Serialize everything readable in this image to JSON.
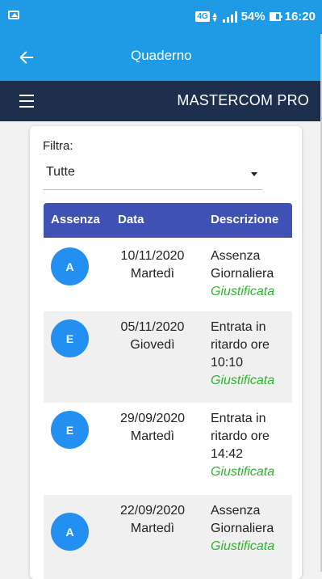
{
  "status_bar": {
    "network": "4G",
    "battery": "54%",
    "time": "16:20",
    "icons": [
      "gallery-icon",
      "signal-icon",
      "battery-icon"
    ]
  },
  "app_bar": {
    "title": "Quaderno",
    "back_icon": "arrow-left-icon"
  },
  "nav_bar": {
    "brand": "MASTERCOM PRO",
    "menu_icon": "hamburger-icon"
  },
  "filter": {
    "label": "Filtra:",
    "value": "Tutte"
  },
  "table": {
    "headers": [
      "Assenza",
      "Data",
      "Descrizione"
    ],
    "rows": [
      {
        "type": "A",
        "date": "10/11/2020",
        "day": "Martedì",
        "desc": [
          "Assenza",
          "Giornaliera"
        ],
        "status": "Giustificata"
      },
      {
        "type": "E",
        "date": "05/11/2020",
        "day": "Giovedì",
        "desc": [
          "Entrata in",
          "ritardo ore",
          "10:10"
        ],
        "status": "Giustificata"
      },
      {
        "type": "E",
        "date": "29/09/2020",
        "day": "Martedì",
        "desc": [
          "Entrata in",
          "ritardo ore",
          "14:42"
        ],
        "status": "Giustificata"
      },
      {
        "type": "A",
        "date": "22/09/2020",
        "day": "Martedì",
        "desc": [
          "Assenza",
          "Giornaliera"
        ],
        "status": "Giustificata"
      }
    ]
  },
  "colors": {
    "primary": "#1f9be6",
    "nav": "#1e2f4d",
    "header": "#3f51b5",
    "badge": "#2390f1",
    "status_ok": "#2db52d"
  }
}
